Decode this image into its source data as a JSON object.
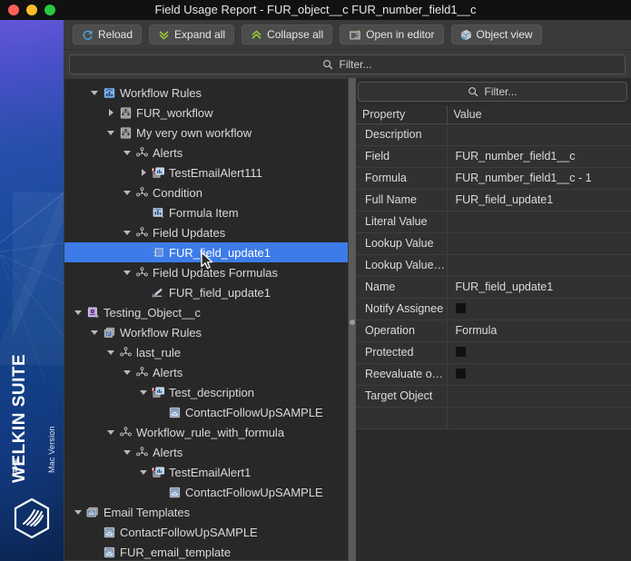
{
  "window": {
    "title": "Field Usage Report - FUR_object__c FUR_number_field1__c",
    "traffic_lights": [
      "close",
      "minimize",
      "maximize"
    ]
  },
  "brand": {
    "the": "THE",
    "name": "WELKIN SUITE",
    "subtitle": "Mac Version",
    "logo_icon": "welkin-hexagon-logo"
  },
  "toolbar": {
    "buttons": [
      {
        "label": "Reload",
        "icon": "reload-icon",
        "color": "#4aa3e0"
      },
      {
        "label": "Expand all",
        "icon": "chevron-double-down-icon",
        "color": "#9acd3a"
      },
      {
        "label": "Collapse all",
        "icon": "chevron-double-up-icon",
        "color": "#9acd3a"
      },
      {
        "label": "Open in editor",
        "icon": "open-in-editor-icon",
        "color": "#9acd3a"
      },
      {
        "label": "Object view",
        "icon": "object-view-icon",
        "color": "#a9b6c4"
      }
    ]
  },
  "global_filter": {
    "placeholder": "Filter...",
    "value": "",
    "icon": "search-icon"
  },
  "detail_filter": {
    "placeholder": "Filter...",
    "value": "",
    "icon": "search-icon"
  },
  "tree": {
    "nodes": [
      {
        "indent": 1,
        "twist": "open",
        "icon": "workflow-rules-folder-icon",
        "label": "Workflow Rules",
        "selected": false
      },
      {
        "indent": 2,
        "twist": "closed",
        "icon": "workflow-icon",
        "label": "FUR_workflow",
        "selected": false
      },
      {
        "indent": 2,
        "twist": "open",
        "icon": "workflow-icon",
        "label": "My very own workflow",
        "selected": false
      },
      {
        "indent": 3,
        "twist": "open",
        "icon": "node-group-icon",
        "label": "Alerts",
        "selected": false
      },
      {
        "indent": 4,
        "twist": "closed",
        "icon": "email-alert-icon",
        "label": "TestEmailAlert111",
        "selected": false
      },
      {
        "indent": 3,
        "twist": "open",
        "icon": "node-group-icon",
        "label": "Condition",
        "selected": false
      },
      {
        "indent": 4,
        "twist": "none",
        "icon": "formula-item-icon",
        "label": "Formula Item",
        "selected": false
      },
      {
        "indent": 3,
        "twist": "open",
        "icon": "node-group-icon",
        "label": "Field Updates",
        "selected": false
      },
      {
        "indent": 4,
        "twist": "none",
        "icon": "field-update-icon",
        "label": "FUR_field_update1",
        "selected": true
      },
      {
        "indent": 3,
        "twist": "open",
        "icon": "node-group-icon",
        "label": "Field Updates Formulas",
        "selected": false
      },
      {
        "indent": 4,
        "twist": "none",
        "icon": "formula-update-icon",
        "label": "FUR_field_update1",
        "selected": false
      },
      {
        "indent": 0,
        "twist": "open",
        "icon": "custom-object-icon",
        "label": "Testing_Object__c",
        "selected": false
      },
      {
        "indent": 1,
        "twist": "open",
        "icon": "workflow-rules-stack-icon",
        "label": "Workflow Rules",
        "selected": false
      },
      {
        "indent": 2,
        "twist": "open",
        "icon": "node-group-icon",
        "label": "last_rule",
        "selected": false
      },
      {
        "indent": 3,
        "twist": "open",
        "icon": "node-group-icon",
        "label": "Alerts",
        "selected": false
      },
      {
        "indent": 4,
        "twist": "open",
        "icon": "email-alert-icon",
        "label": "Test_description",
        "selected": false
      },
      {
        "indent": 5,
        "twist": "none",
        "icon": "email-template-icon",
        "label": "ContactFollowUpSAMPLE",
        "selected": false
      },
      {
        "indent": 2,
        "twist": "open",
        "icon": "node-group-icon",
        "label": "Workflow_rule_with_formula",
        "selected": false
      },
      {
        "indent": 3,
        "twist": "open",
        "icon": "node-group-icon",
        "label": "Alerts",
        "selected": false
      },
      {
        "indent": 4,
        "twist": "open",
        "icon": "email-alert-icon",
        "label": "TestEmailAlert1",
        "selected": false
      },
      {
        "indent": 5,
        "twist": "none",
        "icon": "email-template-icon",
        "label": "ContactFollowUpSAMPLE",
        "selected": false
      },
      {
        "indent": 0,
        "twist": "open",
        "icon": "email-templates-folder-icon",
        "label": "Email Templates",
        "selected": false
      },
      {
        "indent": 1,
        "twist": "none",
        "icon": "email-template-icon",
        "label": "ContactFollowUpSAMPLE",
        "selected": false
      },
      {
        "indent": 1,
        "twist": "none",
        "icon": "email-template-icon",
        "label": "FUR_email_template",
        "selected": false
      }
    ]
  },
  "properties": {
    "columns": [
      "Property",
      "Value"
    ],
    "rows": [
      {
        "name": "Description",
        "value": "",
        "type": "text"
      },
      {
        "name": "Field",
        "value": "FUR_number_field1__c",
        "type": "text"
      },
      {
        "name": "Formula",
        "value": "FUR_number_field1__c - 1",
        "type": "text"
      },
      {
        "name": "Full Name",
        "value": "FUR_field_update1",
        "type": "text"
      },
      {
        "name": "Literal Value",
        "value": "",
        "type": "text"
      },
      {
        "name": "Lookup Value",
        "value": "",
        "type": "text"
      },
      {
        "name": "Lookup Value T..",
        "value": "",
        "type": "text"
      },
      {
        "name": "Name",
        "value": "FUR_field_update1",
        "type": "text"
      },
      {
        "name": "Notify Assignee",
        "value": "",
        "type": "checkbox"
      },
      {
        "name": "Operation",
        "value": "Formula",
        "type": "text"
      },
      {
        "name": "Protected",
        "value": "",
        "type": "checkbox"
      },
      {
        "name": "Reevaluate on...",
        "value": "",
        "type": "checkbox"
      },
      {
        "name": "Target Object",
        "value": "",
        "type": "text"
      }
    ]
  },
  "colors": {
    "selection_blue": "#3d7ce8",
    "toolbar_bg": "#3a3a3a",
    "pane_bg": "#2b2b2b",
    "titlebar_bg": "#111111"
  }
}
